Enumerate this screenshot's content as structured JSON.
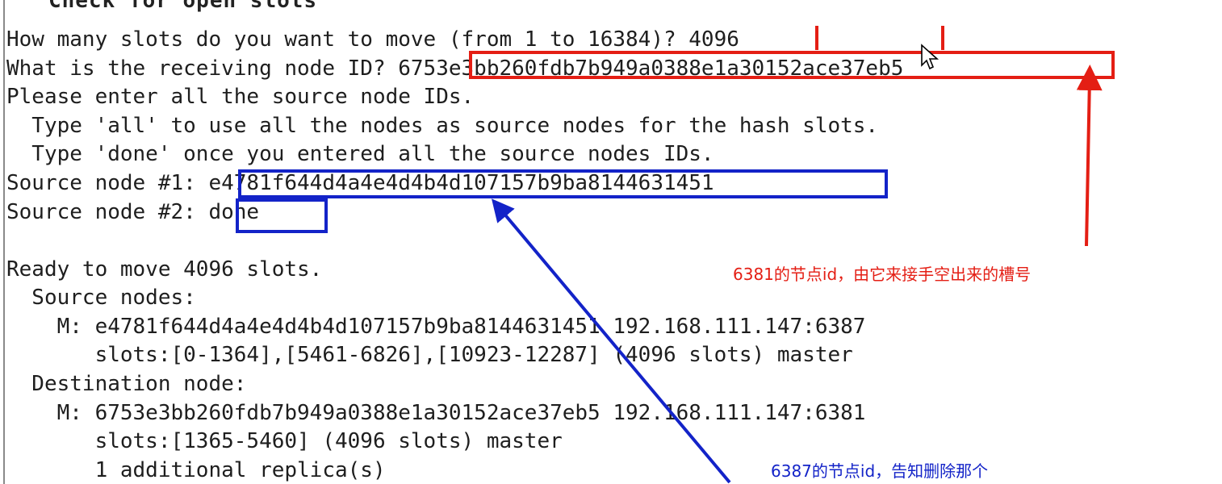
{
  "terminal": {
    "top_cutoff": "Check for open slots",
    "lines": [
      "How many slots do you want to move (from 1 to 16384)? 4096",
      "What is the receiving node ID? 6753e3bb260fdb7b949a0388e1a30152ace37eb5",
      "Please enter all the source node IDs.",
      "  Type 'all' to use all the nodes as source nodes for the hash slots.",
      "  Type 'done' once you entered all the source nodes IDs.",
      "Source node #1: e4781f644d4a4e4d4b4d107157b9ba8144631451",
      "Source node #2: done",
      "",
      "Ready to move 4096 slots.",
      "  Source nodes:",
      "    M: e4781f644d4a4e4d4b4d107157b9ba8144631451 192.168.111.147:6387",
      "       slots:[0-1364],[5461-6826],[10923-12287] (4096 slots) master",
      "  Destination node:",
      "    M: 6753e3bb260fdb7b949a0388e1a30152ace37eb5 192.168.111.147:6381",
      "       slots:[1365-5460] (4096 slots) master",
      "       1 additional replica(s)"
    ]
  },
  "annotations": {
    "red_note": "6381的节点id，由它来接手空出来的槽号",
    "blue_note": "6387的节点id，告知删除那个"
  },
  "colors": {
    "annotation_red": "#e41e14",
    "annotation_blue": "#1323c8",
    "terminal_text": "#1e1e1e",
    "background": "#ffffff"
  }
}
